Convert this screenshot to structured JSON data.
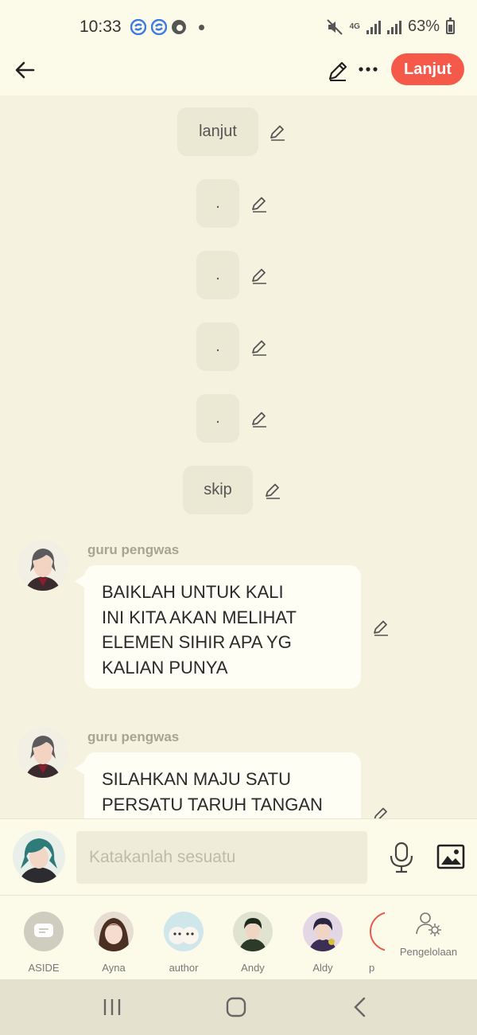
{
  "status_bar": {
    "time": "10:33",
    "network": "4G",
    "battery": "63%"
  },
  "header": {
    "continue_label": "Lanjut"
  },
  "narration": [
    {
      "text": "lanjut"
    },
    {
      "text": "."
    },
    {
      "text": "."
    },
    {
      "text": "."
    },
    {
      "text": "."
    },
    {
      "text": "skip"
    }
  ],
  "messages": [
    {
      "sender": "guru pengwas",
      "lines": [
        "BAIKLAH UNTUK KALI",
        "INI KITA AKAN MELIHAT",
        "ELEMEN SIHIR APA YG",
        "KALIAN PUNYA"
      ]
    },
    {
      "sender": "guru pengwas",
      "lines": [
        "SILAHKAN MAJU SATU",
        "PERSATU  TARUH TANGAN"
      ]
    }
  ],
  "input": {
    "placeholder": "Katakanlah sesuatu"
  },
  "characters": [
    {
      "name": "ASIDE",
      "icon": "chat-bubble-icon"
    },
    {
      "name": "Ayna",
      "icon": "avatar"
    },
    {
      "name": "author",
      "icon": "avatar"
    },
    {
      "name": "Andy",
      "icon": "avatar"
    },
    {
      "name": "Aldy",
      "icon": "avatar"
    },
    {
      "name": "p",
      "icon": "avatar"
    }
  ],
  "manage_label": "Pengelolaan",
  "colors": {
    "accent": "#f5594a",
    "background": "#fcfbea",
    "chat_background": "#f5f3df",
    "narration_bubble": "#ebe8d4",
    "message_bubble": "#fffef5"
  }
}
